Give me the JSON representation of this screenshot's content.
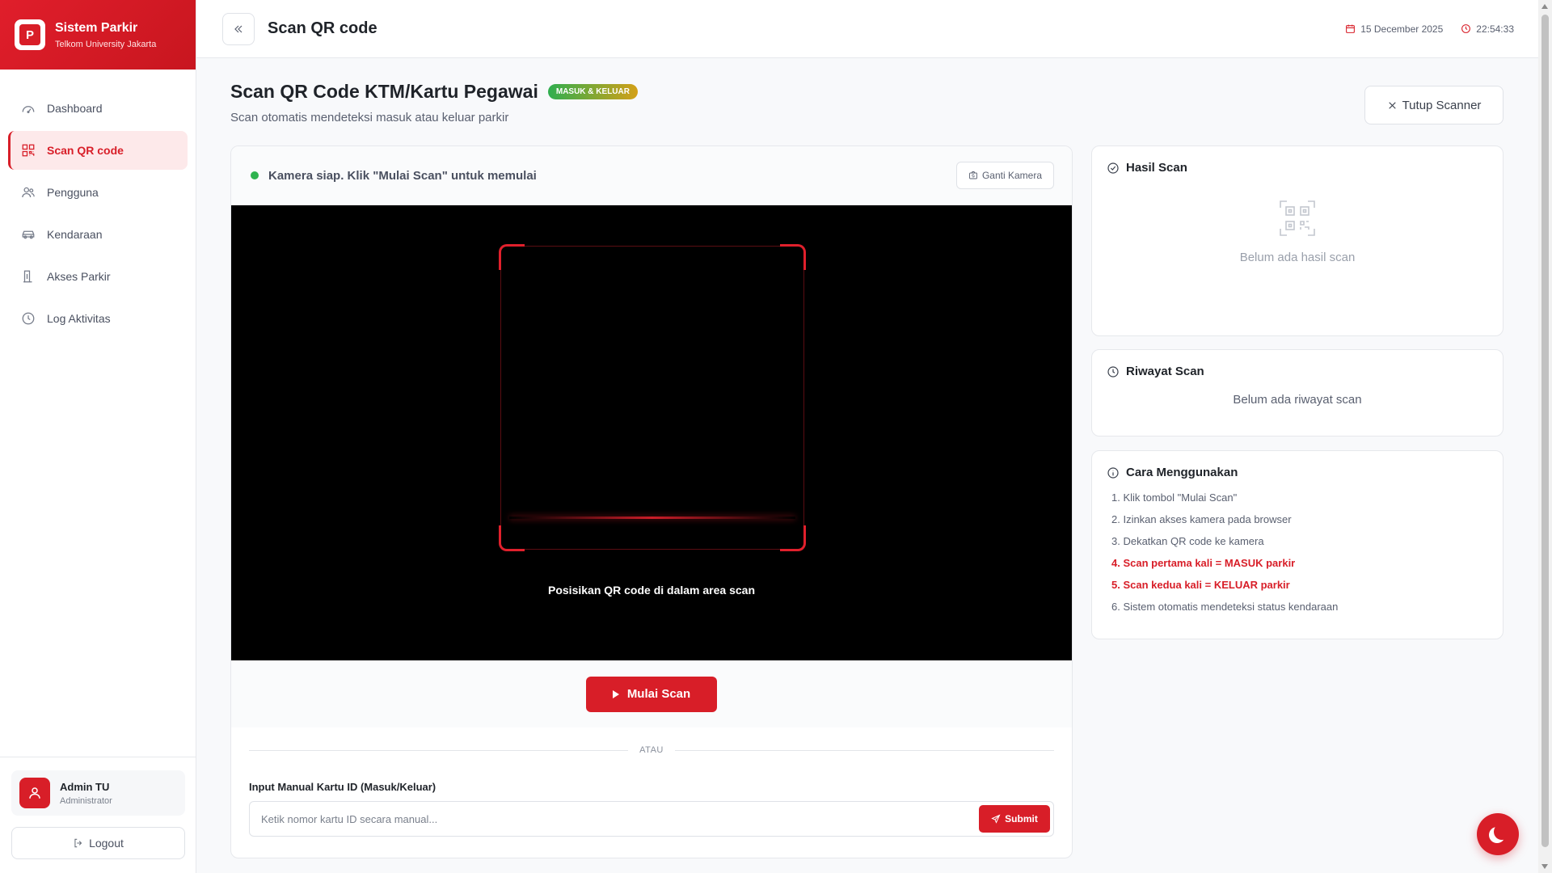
{
  "brand": {
    "logo_letter": "P",
    "title": "Sistem Parkir",
    "subtitle": "Telkom University Jakarta",
    "color": "#d81e28"
  },
  "sidebar": {
    "items": [
      {
        "label": "Dashboard",
        "icon": "dashboard-icon",
        "active": false
      },
      {
        "label": "Scan QR code",
        "icon": "qr-code-icon",
        "active": true
      },
      {
        "label": "Pengguna",
        "icon": "users-icon",
        "active": false
      },
      {
        "label": "Kendaraan",
        "icon": "car-icon",
        "active": false
      },
      {
        "label": "Akses Parkir",
        "icon": "gate-icon",
        "active": false
      },
      {
        "label": "Log Aktivitas",
        "icon": "clock-icon",
        "active": false
      }
    ],
    "user": {
      "name": "Admin TU",
      "role": "Administrator"
    },
    "logout_label": "Logout"
  },
  "topbar": {
    "title": "Scan QR code",
    "date": "15 December 2025",
    "time": "22:54:33"
  },
  "page": {
    "title": "Scan QR Code KTM/Kartu Pegawai",
    "badge": "MASUK & KELUAR",
    "subtitle": "Scan otomatis mendeteksi masuk atau keluar parkir",
    "close_scanner_label": "Tutup Scanner"
  },
  "scanner": {
    "status": "Kamera siap. Klik \"Mulai Scan\" untuk memulai",
    "switch_camera_label": "Ganti Kamera",
    "hint": "Posisikan QR code di dalam area scan",
    "start_label": "Mulai Scan",
    "divider": "ATAU",
    "manual_label": "Input Manual Kartu ID (Masuk/Keluar)",
    "manual_placeholder": "Ketik nomor kartu ID secara manual...",
    "manual_value": "",
    "submit_label": "Submit"
  },
  "result": {
    "title": "Hasil Scan",
    "empty": "Belum ada hasil scan"
  },
  "history": {
    "title": "Riwayat Scan",
    "empty": "Belum ada riwayat scan"
  },
  "howto": {
    "title": "Cara Menggunakan",
    "steps": [
      "1. Klik tombol \"Mulai Scan\"",
      "2. Izinkan akses kamera pada browser",
      "3. Dekatkan QR code ke kamera",
      "4. Scan pertama kali = MASUK parkir",
      "5. Scan kedua kali = KELUAR parkir",
      "6. Sistem otomatis mendeteksi status kendaraan"
    ]
  }
}
